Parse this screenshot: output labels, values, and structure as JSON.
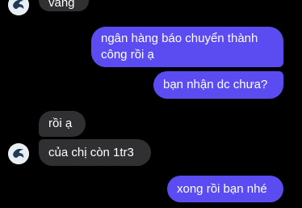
{
  "conversation": {
    "messages": [
      {
        "sender": "other",
        "text": "vâng"
      },
      {
        "sender": "me",
        "line1": "ngân hàng báo chuyển thành",
        "line2": "công rồi ạ"
      },
      {
        "sender": "me",
        "text": "bạn nhận dc chưa?"
      },
      {
        "sender": "other",
        "text": "rồi ạ"
      },
      {
        "sender": "other",
        "text": "của chị còn 1tr3"
      },
      {
        "sender": "me",
        "text": "xong rồi bạn nhé"
      }
    ]
  },
  "theme": {
    "background": "#000000",
    "incoming_bubble": "#303033",
    "outgoing_bubble": "#5b4cf2",
    "text": "#ffffff"
  },
  "icons": {
    "contact_avatar": "dragon-logo-avatar"
  }
}
